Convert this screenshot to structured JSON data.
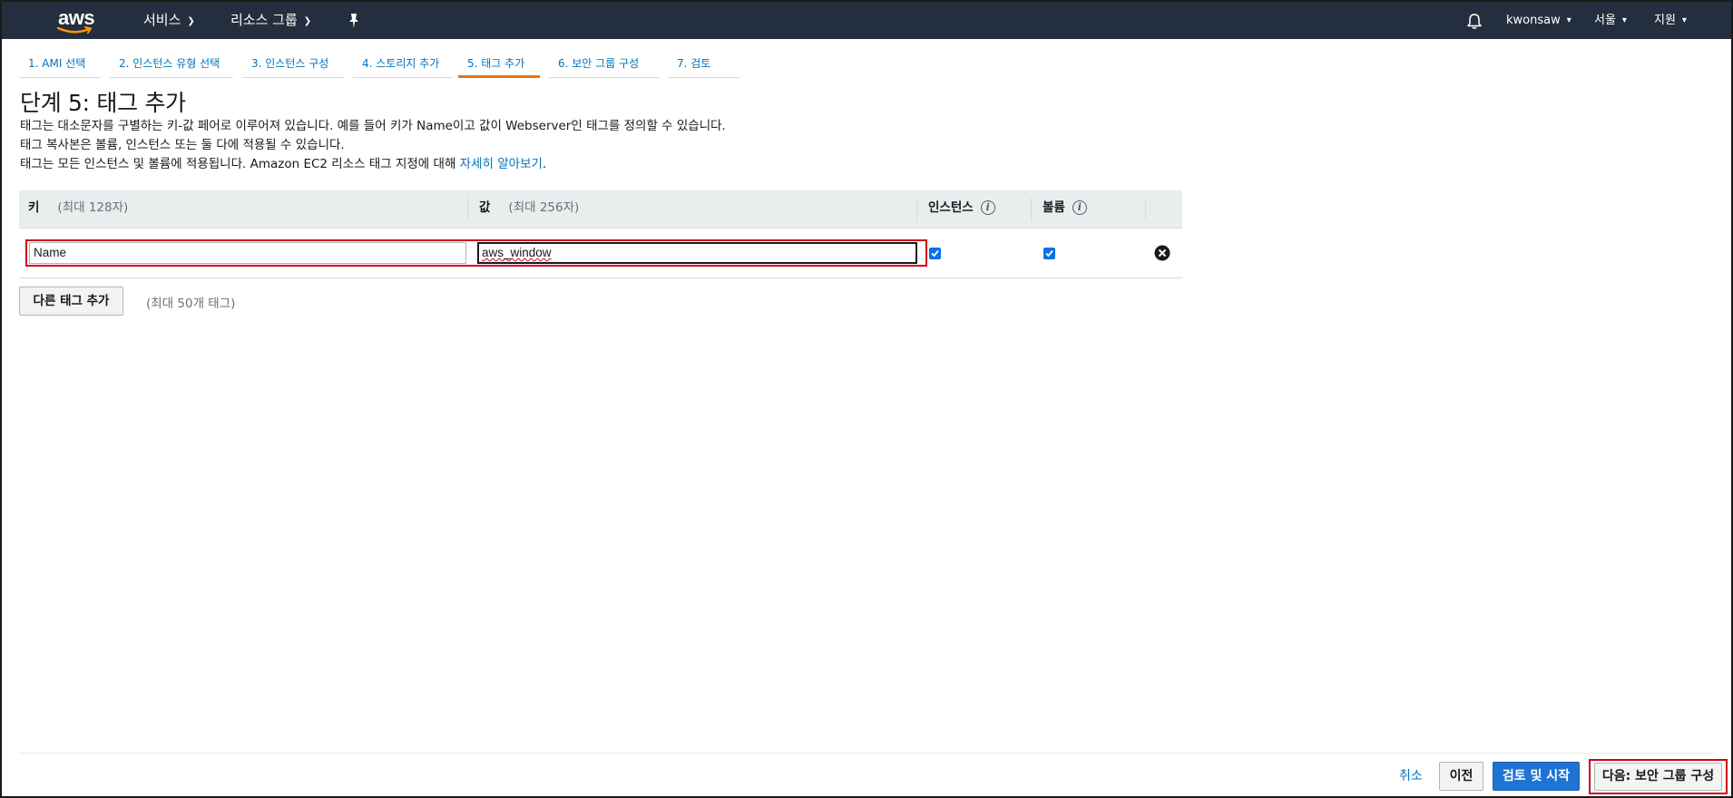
{
  "header": {
    "logo_text": "aws",
    "services_label": "서비스",
    "resource_groups_label": "리소스 그룹",
    "user_label": "kwonsaw",
    "region_label": "서울",
    "support_label": "지원",
    "bg_color": "#232f3e"
  },
  "tabs": [
    {
      "label": "1. AMI 선택"
    },
    {
      "label": "2. 인스턴스 유형 선택"
    },
    {
      "label": "3. 인스턴스 구성"
    },
    {
      "label": "4. 스토리지 추가"
    },
    {
      "label": "5. 태그 추가",
      "active": true
    },
    {
      "label": "6. 보안 그룹 구성"
    },
    {
      "label": "7. 검토"
    }
  ],
  "page": {
    "title": "단계 5: 태그 추가",
    "desc_line1": "태그는 대소문자를 구별하는 키-값 페어로 이루어져 있습니다. 예를 들어 키가 Name이고 값이 Webserver인 태그를 정의할 수 있습니다.",
    "desc_line2": "태그 복사본은 볼륨, 인스턴스 또는 둘 다에 적용될 수 있습니다.",
    "desc_line3_prefix": "태그는 모든 인스턴스 및 볼륨에 적용됩니다. Amazon EC2 리소스 태그 지정에 대해",
    "desc_link": "자세히 알아보기",
    "desc_line3_suffix": "."
  },
  "table": {
    "col_key": "키",
    "col_key_hint": "(최대 128자)",
    "col_value": "값",
    "col_value_hint": "(최대 256자)",
    "col_instances": "인스턴스",
    "col_volumes": "볼륨",
    "rows": [
      {
        "key": "Name",
        "value": "aws_window",
        "instances": true,
        "volumes": true
      }
    ]
  },
  "add_tag": {
    "button_label": "다른 태그 추가",
    "hint": "(최대 50개 태그)"
  },
  "footer": {
    "cancel_label": "취소",
    "prev_label": "이전",
    "review_label": "검토 및 시작",
    "next_label": "다음: 보안 그룹 구성"
  },
  "colors": {
    "accent_blue": "#0073bb",
    "primary_button": "#1f73d3",
    "active_tab": "#ec7211",
    "highlight_red": "#d0021b"
  }
}
